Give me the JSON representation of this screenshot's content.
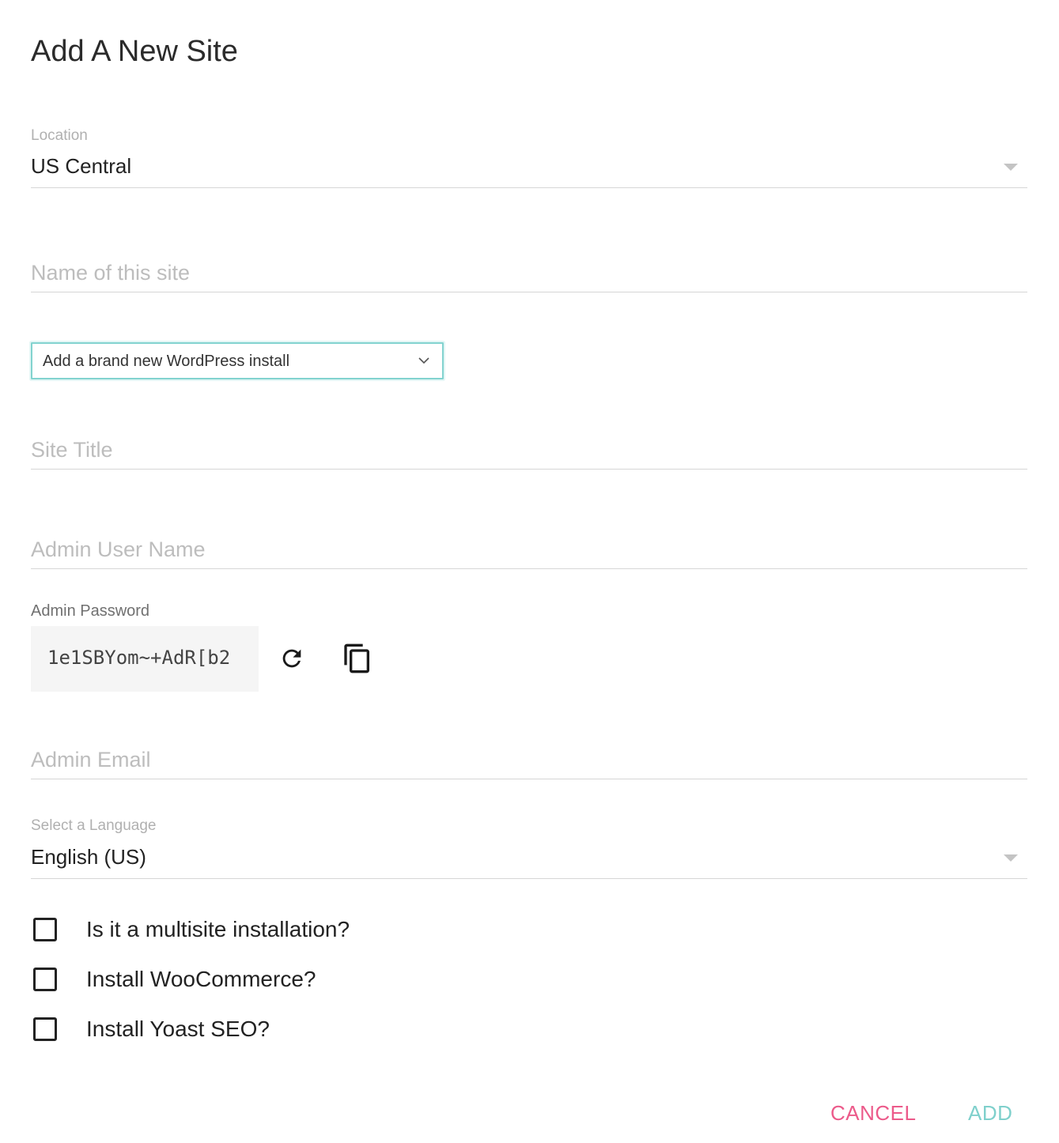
{
  "dialog": {
    "title": "Add A New Site"
  },
  "location": {
    "label": "Location",
    "value": "US Central"
  },
  "site_name": {
    "placeholder": "Name of this site",
    "value": ""
  },
  "install_type": {
    "selected": "Add a brand new WordPress install"
  },
  "site_title": {
    "placeholder": "Site Title",
    "value": ""
  },
  "admin_user": {
    "placeholder": "Admin User Name",
    "value": ""
  },
  "admin_password": {
    "label": "Admin Password",
    "value": "1e1SBYom~+AdR[b2",
    "regenerate_icon": "refresh-icon",
    "copy_icon": "copy-icon"
  },
  "admin_email": {
    "placeholder": "Admin Email",
    "value": ""
  },
  "language": {
    "label": "Select a Language",
    "value": "English (US)"
  },
  "options": [
    {
      "label": "Is it a multisite installation?",
      "checked": false
    },
    {
      "label": "Install WooCommerce?",
      "checked": false
    },
    {
      "label": "Install Yoast SEO?",
      "checked": false
    }
  ],
  "actions": {
    "cancel_label": "CANCEL",
    "add_label": "ADD"
  },
  "colors": {
    "cancel": "#ec5a8a",
    "add": "#7fd0cc",
    "focus_border": "#82d3cf"
  }
}
